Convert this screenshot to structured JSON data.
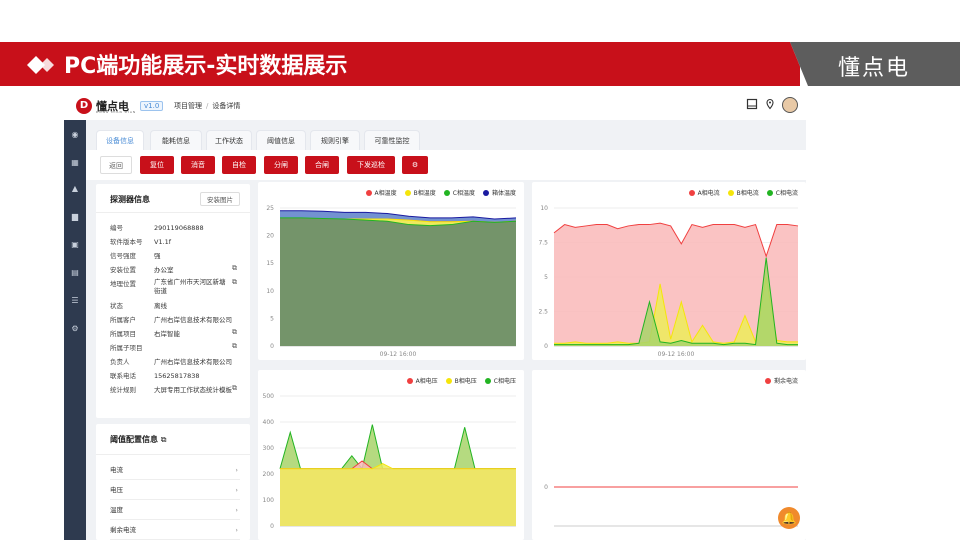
{
  "banner": {
    "title": "PC端功能展示-实时数据展示",
    "brand": "懂点电"
  },
  "app": {
    "logo_letter": "D",
    "name": "懂点电",
    "sub": "DONG DIAN DIAN",
    "version": "v1.0",
    "breadcrumb": [
      "项目管理",
      "设备详情"
    ],
    "sidebar_icons": [
      "dashboard-icon",
      "grid-icon",
      "alarm-icon",
      "building-icon",
      "device-icon",
      "document-icon",
      "list-icon",
      "settings-icon"
    ]
  },
  "tabs": [
    "设备信息",
    "能耗信息",
    "工作状态",
    "阈值信息",
    "规则引擎",
    "可靠性监控"
  ],
  "toolbar": {
    "back": "返回",
    "buttons": [
      "复位",
      "消音",
      "自检",
      "分闸",
      "合闸",
      "下发巡检"
    ],
    "gear": "⚙"
  },
  "info": {
    "title": "探测器信息",
    "install_btn": "安装图片",
    "rows": [
      {
        "k": "编号",
        "v": "290119068888",
        "edit": false
      },
      {
        "k": "软件版本号",
        "v": "V1.1f",
        "edit": false
      },
      {
        "k": "信号强度",
        "v": "强",
        "edit": false
      },
      {
        "k": "安装位置",
        "v": "办公室",
        "edit": true
      },
      {
        "k": "地理位置",
        "v": "广东省广州市天河区新塘街道",
        "edit": true
      },
      {
        "k": "状态",
        "v": "离线",
        "edit": false
      },
      {
        "k": "所属客户",
        "v": "广州右岸信息技术有限公司",
        "edit": false
      },
      {
        "k": "所属项目",
        "v": "右岸智能",
        "edit": true
      },
      {
        "k": "所属子项目",
        "v": "",
        "edit": true
      },
      {
        "k": "负责人",
        "v": "广州右岸信息技术有限公司",
        "edit": false
      },
      {
        "k": "联系电话",
        "v": "15625817838",
        "edit": false
      },
      {
        "k": "统计规则",
        "v": "大屏专用工作状态统计模板",
        "edit": true
      }
    ]
  },
  "threshold": {
    "title": "阈值配置信息",
    "items": [
      "电流",
      "电压",
      "温度",
      "剩余电流"
    ]
  },
  "chart_data": [
    {
      "type": "area",
      "legend": [
        "A相温度",
        "B相温度",
        "C相温度",
        "箱体温度"
      ],
      "colors": [
        "#f04040",
        "#f5e50a",
        "#22b422",
        "#1a1aa0"
      ],
      "yticks": [
        0,
        5,
        10,
        15,
        20,
        25
      ],
      "ylim": [
        0,
        25
      ],
      "xlabel": "09-12 16:00",
      "series": [
        {
          "name": "A相温度",
          "values": [
            23,
            23,
            23,
            23,
            23,
            23,
            22.8,
            22.5,
            22.5,
            22.6,
            22.4,
            22.6
          ]
        },
        {
          "name": "B相温度",
          "values": [
            23,
            23,
            23,
            23,
            23,
            23,
            22.8,
            22.5,
            22.5,
            22.6,
            22.4,
            22.6
          ]
        },
        {
          "name": "C相温度",
          "values": [
            23.2,
            23.2,
            23.1,
            23,
            22.8,
            22.6,
            22,
            21.8,
            22,
            22.6,
            22.4,
            22.6
          ]
        },
        {
          "name": "箱体温度",
          "values": [
            24.5,
            24.5,
            24.4,
            24.2,
            24.2,
            24,
            23.5,
            23.2,
            23.2,
            23.4,
            23,
            23.2
          ]
        }
      ]
    },
    {
      "type": "area",
      "legend": [
        "A相电流",
        "B相电流",
        "C相电流"
      ],
      "colors": [
        "#f04040",
        "#f5e50a",
        "#22b422"
      ],
      "yticks": [
        0,
        2.5,
        5,
        7.5,
        10
      ],
      "ylim": [
        0,
        10
      ],
      "xlabel": "09-12 16:00",
      "series": [
        {
          "name": "A相电流",
          "values": [
            8.2,
            8.8,
            8.6,
            8.7,
            8.8,
            8.8,
            8.5,
            8.7,
            8.8,
            8.8,
            8.9,
            8.7,
            7.4,
            8.8,
            8.6,
            8.8,
            8.8,
            8.8,
            8.6,
            8.8,
            6.5,
            8.8,
            8.8,
            8.7
          ]
        },
        {
          "name": "B相电流",
          "values": [
            0.2,
            0.2,
            0.3,
            0.2,
            0.2,
            0.2,
            0.3,
            0.2,
            0.2,
            0.3,
            4.5,
            0.5,
            3.2,
            0.3,
            1.5,
            0.3,
            0.2,
            0.3,
            2.2,
            0.3,
            5,
            0.4,
            0.3,
            0.3
          ]
        },
        {
          "name": "C相电流",
          "values": [
            0.1,
            0.1,
            0.1,
            0.1,
            0.1,
            0.1,
            0.1,
            0.1,
            0.2,
            3.2,
            0.3,
            0.2,
            0.4,
            0.2,
            0.2,
            0.2,
            0.1,
            0.2,
            0.2,
            0.1,
            6.4,
            0.2,
            0.1,
            0.1
          ]
        }
      ]
    },
    {
      "type": "area",
      "legend": [
        "A相电压",
        "B相电压",
        "C相电压"
      ],
      "colors": [
        "#f04040",
        "#f5e50a",
        "#22b422"
      ],
      "yticks": [
        0,
        100,
        200,
        300,
        400,
        500
      ],
      "ylim": [
        0,
        500
      ],
      "series": [
        {
          "name": "A相电压",
          "values": [
            220,
            220,
            220,
            220,
            220,
            220,
            220,
            220,
            250,
            220,
            220,
            220,
            220,
            220,
            220,
            220,
            220,
            220,
            220,
            220,
            220,
            220,
            220,
            220
          ]
        },
        {
          "name": "B相电压",
          "values": [
            220,
            220,
            220,
            220,
            220,
            220,
            220,
            220,
            220,
            220,
            240,
            220,
            220,
            220,
            220,
            220,
            220,
            220,
            220,
            220,
            220,
            220,
            220,
            220
          ]
        },
        {
          "name": "C相电压",
          "values": [
            220,
            360,
            220,
            220,
            220,
            220,
            220,
            270,
            220,
            390,
            220,
            220,
            220,
            220,
            220,
            220,
            220,
            220,
            380,
            220,
            220,
            220,
            220,
            220
          ]
        }
      ]
    },
    {
      "type": "line",
      "legend": [
        "剩余电流"
      ],
      "colors": [
        "#f04040"
      ],
      "yticks": [
        0
      ],
      "series": [
        {
          "name": "剩余电流",
          "values": [
            0,
            0,
            0,
            0,
            0,
            0,
            0,
            0,
            0,
            0
          ]
        }
      ]
    }
  ]
}
